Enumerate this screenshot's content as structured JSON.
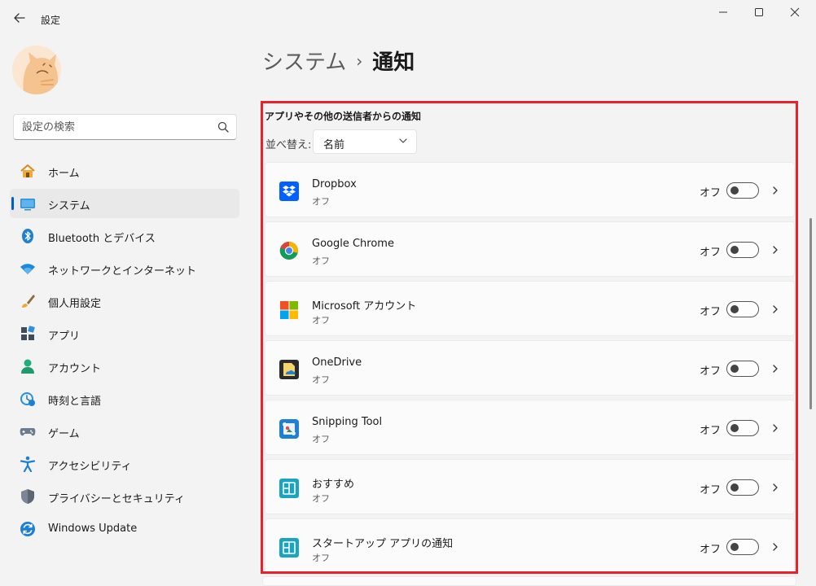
{
  "window": {
    "title": "設定",
    "back_icon": "back-arrow-icon",
    "controls": [
      "minimize-icon",
      "maximize-icon",
      "close-icon"
    ]
  },
  "search": {
    "placeholder": "設定の検索",
    "icon": "search-icon"
  },
  "sidebar": {
    "items": [
      {
        "label": "ホーム",
        "icon": "home-icon",
        "active": false
      },
      {
        "label": "システム",
        "icon": "system-display-icon",
        "active": true
      },
      {
        "label": "Bluetooth とデバイス",
        "icon": "bluetooth-icon",
        "active": false
      },
      {
        "label": "ネットワークとインターネット",
        "icon": "wifi-icon",
        "active": false
      },
      {
        "label": "個人用設定",
        "icon": "paint-brush-icon",
        "active": false
      },
      {
        "label": "アプリ",
        "icon": "apps-icon",
        "active": false
      },
      {
        "label": "アカウント",
        "icon": "account-icon",
        "active": false
      },
      {
        "label": "時刻と言語",
        "icon": "time-language-icon",
        "active": false
      },
      {
        "label": "ゲーム",
        "icon": "gamepad-icon",
        "active": false
      },
      {
        "label": "アクセシビリティ",
        "icon": "accessibility-icon",
        "active": false
      },
      {
        "label": "プライバシーとセキュリティ",
        "icon": "shield-icon",
        "active": false
      },
      {
        "label": "Windows Update",
        "icon": "windows-update-icon",
        "active": false
      }
    ]
  },
  "breadcrumb": {
    "parent": "システム",
    "separator": "›",
    "current": "通知"
  },
  "section": {
    "title": "アプリやその他の送信者からの通知",
    "sort_label": "並べ替え:",
    "sort_value": "名前"
  },
  "apps": [
    {
      "name": "Dropbox",
      "status": "オフ",
      "toggle_label": "オフ",
      "toggle_on": false,
      "icon": "dropbox-icon"
    },
    {
      "name": "Google Chrome",
      "status": "オフ",
      "toggle_label": "オフ",
      "toggle_on": false,
      "icon": "chrome-icon"
    },
    {
      "name": "Microsoft アカウント",
      "status": "オフ",
      "toggle_label": "オフ",
      "toggle_on": false,
      "icon": "microsoft-icon"
    },
    {
      "name": "OneDrive",
      "status": "オフ",
      "toggle_label": "オフ",
      "toggle_on": false,
      "icon": "onedrive-icon"
    },
    {
      "name": "Snipping Tool",
      "status": "オフ",
      "toggle_label": "オフ",
      "toggle_on": false,
      "icon": "snipping-tool-icon"
    },
    {
      "name": "おすすめ",
      "status": "オフ",
      "toggle_label": "オフ",
      "toggle_on": false,
      "icon": "tips-icon"
    },
    {
      "name": "スタートアップ アプリの通知",
      "status": "オフ",
      "toggle_label": "オフ",
      "toggle_on": false,
      "icon": "startup-apps-icon"
    }
  ],
  "colors": {
    "accent": "#005fb8",
    "highlight_border": "#e8212a",
    "background": "#f3f3f3",
    "card": "#fbfbfb"
  }
}
